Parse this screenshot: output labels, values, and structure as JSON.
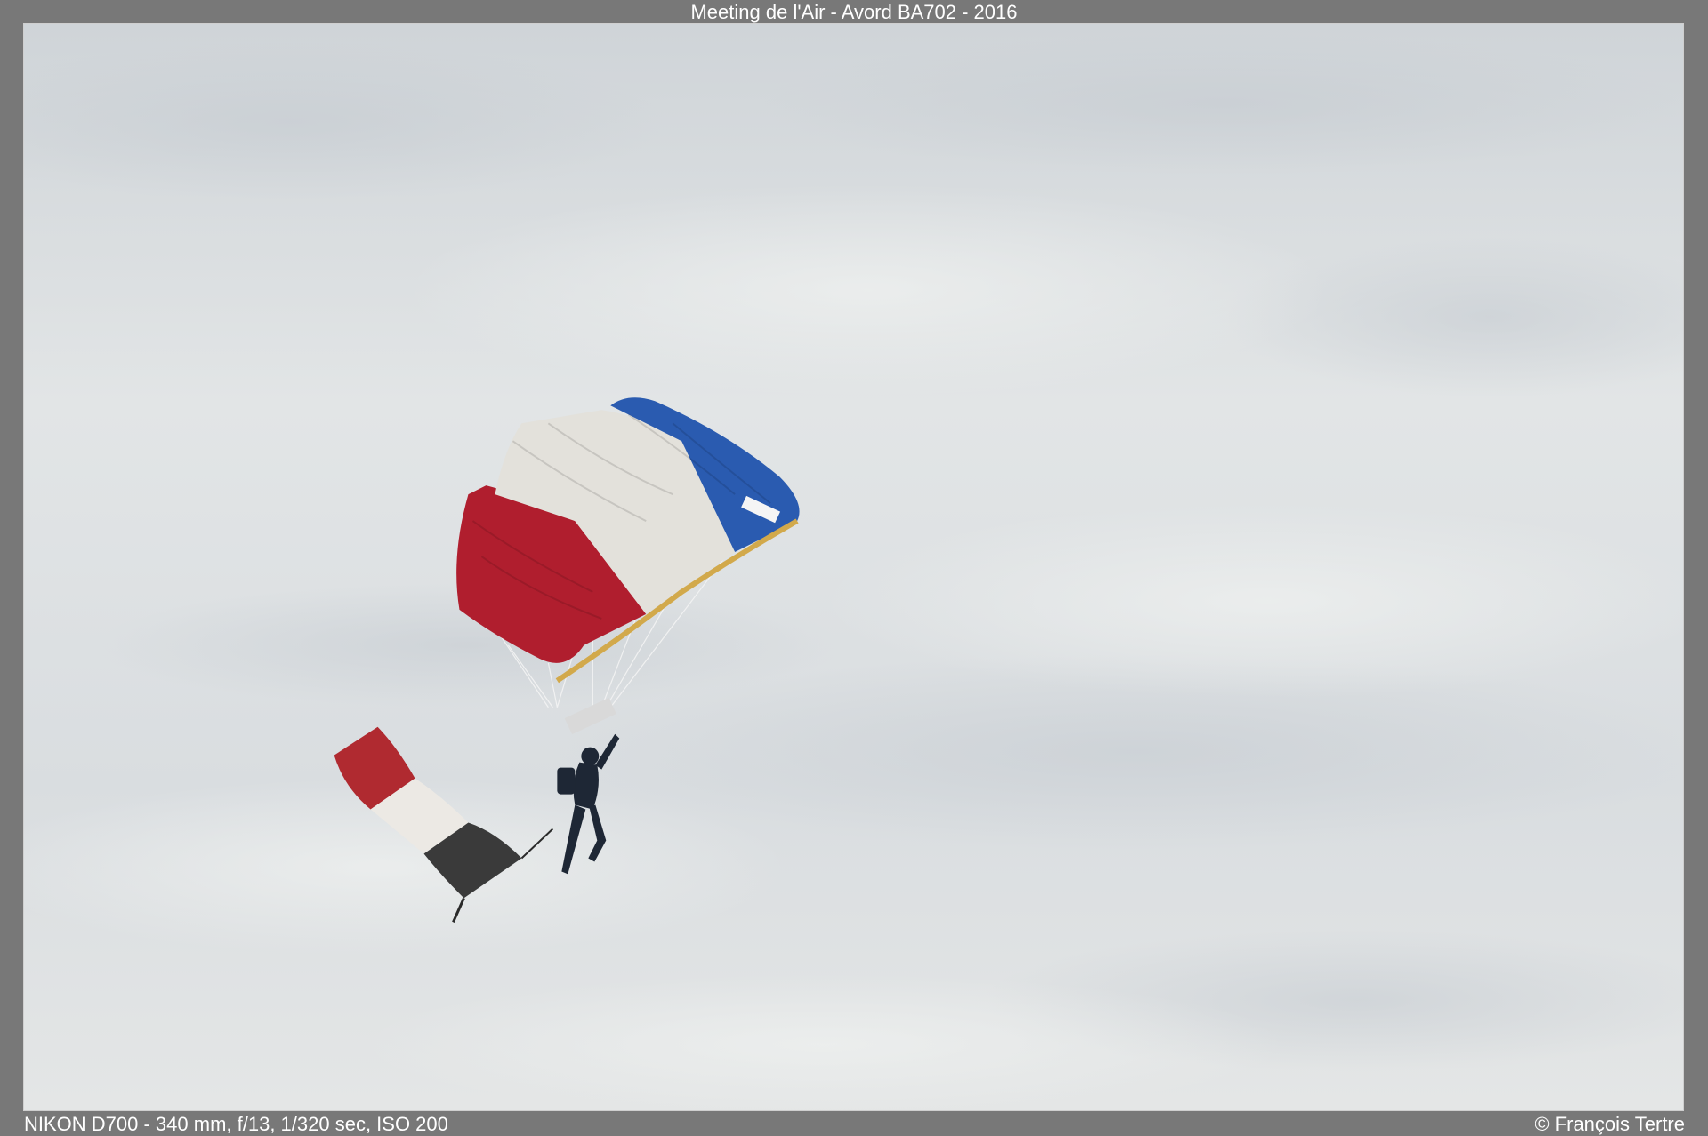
{
  "caption": {
    "title": "Meeting de l'Air - Avord BA702 - 2016",
    "exif": "NIKON D700 - 340 mm, f/13, 1/320 sec, ISO 200",
    "copyright": "© François Tertre"
  },
  "photo": {
    "subject": "parachutist",
    "canopy_colors": [
      "#2a5bb0",
      "#e6e4de",
      "#b01e2e"
    ],
    "flag_colors": [
      "#b02a30",
      "#ece9e4",
      "#3a3a3a"
    ],
    "sky_color": "#dfe2e4",
    "frame_color": "#787878"
  }
}
